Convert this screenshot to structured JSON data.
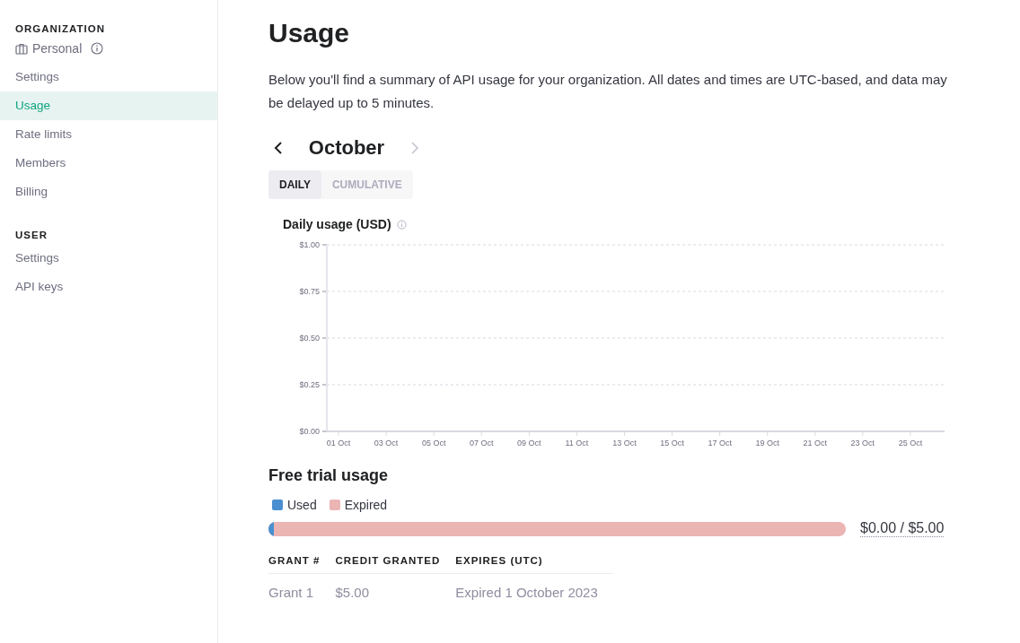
{
  "sidebar": {
    "sections": [
      {
        "heading": "ORGANIZATION",
        "org": "Personal",
        "items": [
          {
            "label": "Settings",
            "selected": false
          },
          {
            "label": "Usage",
            "selected": true
          },
          {
            "label": "Rate limits",
            "selected": false
          },
          {
            "label": "Members",
            "selected": false
          },
          {
            "label": "Billing",
            "selected": false
          }
        ]
      },
      {
        "heading": "USER",
        "items": [
          {
            "label": "Settings",
            "selected": false
          },
          {
            "label": "API keys",
            "selected": false
          }
        ]
      }
    ]
  },
  "page": {
    "title": "Usage",
    "description": "Below you'll find a summary of API usage for your organization. All dates and times are UTC-based, and data may be delayed up to 5 minutes.",
    "month": "October",
    "next_disabled": true,
    "toggle": [
      {
        "label": "DAILY",
        "selected": true
      },
      {
        "label": "CUMULATIVE",
        "selected": false
      }
    ],
    "chart_title": "Daily usage (USD)",
    "chart_data": {
      "type": "bar",
      "categories": [
        "01 Oct",
        "03 Oct",
        "05 Oct",
        "07 Oct",
        "09 Oct",
        "11 Oct",
        "13 Oct",
        "15 Oct",
        "17 Oct",
        "19 Oct",
        "21 Oct",
        "23 Oct",
        "25 Oct"
      ],
      "values": [
        0,
        0,
        0,
        0,
        0,
        0,
        0,
        0,
        0,
        0,
        0,
        0,
        0
      ],
      "grid": true,
      "ylim": [
        0,
        1
      ],
      "yticks": [
        {
          "value": 0,
          "label": "$0.00"
        },
        {
          "value": 0.25,
          "label": "$0.25"
        },
        {
          "value": 0.5,
          "label": "$0.50"
        },
        {
          "value": 0.75,
          "label": "$0.75"
        },
        {
          "value": 1,
          "label": "$1.00"
        }
      ]
    },
    "trial": {
      "title": "Free trial usage",
      "legend": [
        {
          "label": "Used",
          "color": "#4a90d0"
        },
        {
          "label": "Expired",
          "color": "#ebb5b4"
        }
      ],
      "level": 0.01,
      "amount": "$0.00 / $5.00"
    },
    "grants": {
      "columns": [
        "GRANT #",
        "CREDIT GRANTED",
        "EXPIRES (UTC)"
      ],
      "rows": [
        [
          "Grant 1",
          "$5.00",
          "Expired 1 October 2023"
        ]
      ]
    }
  }
}
